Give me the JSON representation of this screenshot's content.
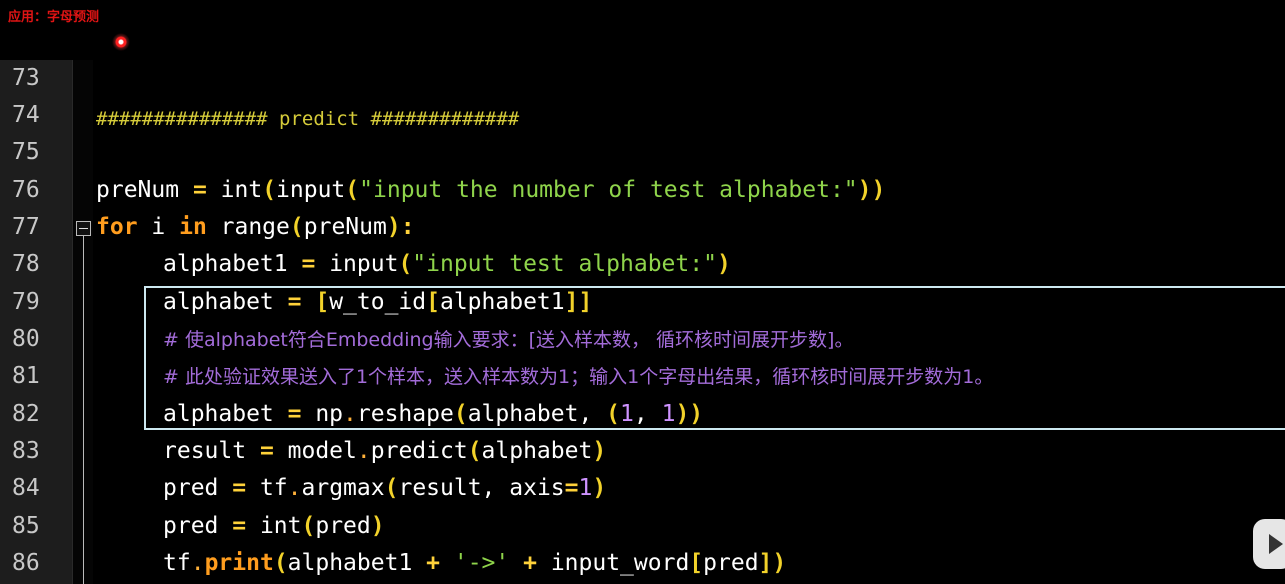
{
  "header": {
    "title": "应用：字母预测"
  },
  "line_numbers": [
    "73",
    "74",
    "75",
    "76",
    "77",
    "78",
    "79",
    "80",
    "81",
    "82",
    "83",
    "84",
    "85",
    "86"
  ],
  "code": {
    "l74_comment": "############### predict #############",
    "l76": {
      "a": "preNum ",
      "eq": "=",
      "b": " int",
      "p1": "(",
      "c": "input",
      "p2": "(",
      "s": "\"input the number of test alphabet:\"",
      "p3": "))"
    },
    "l77": {
      "kw_for": "for",
      "a": " i ",
      "kw_in": "in",
      "b": " range",
      "p1": "(",
      "c": "preNum",
      "p2": ")",
      "colon": ":"
    },
    "l78": {
      "a": "alphabet1 ",
      "eq": "=",
      "b": " input",
      "p1": "(",
      "s": "\"input test alphabet:\"",
      "p2": ")"
    },
    "l79": {
      "a": "alphabet ",
      "eq": "=",
      "p1": " [",
      "b": "w_to_id",
      "p2": "[",
      "c": "alphabet1",
      "p3": "]]"
    },
    "l80_comment": "# 使alphabet符合Embedding输入要求：[送入样本数， 循环核时间展开步数]。",
    "l81_comment": "# 此处验证效果送入了1个样本，送入样本数为1；输入1个字母出结果，循环核时间展开步数为1。",
    "l82": {
      "a": "alphabet ",
      "eq": "=",
      "b": " np",
      "dot": ".",
      "c": "reshape",
      "p1": "(",
      "d": "alphabet",
      "comma": ", ",
      "p2": "(",
      "n1": "1",
      "comma2": ", ",
      "n2": "1",
      "p3": "))"
    },
    "l83": {
      "a": "result ",
      "eq": "=",
      "b": " model",
      "dot": ".",
      "c": "predict",
      "p1": "(",
      "d": "alphabet",
      "p2": ")"
    },
    "l84": {
      "a": "pred ",
      "eq": "=",
      "b": " tf",
      "dot": ".",
      "c": "argmax",
      "p1": "(",
      "d": "result, axis",
      "eq2": "=",
      "n": "1",
      "p2": ")"
    },
    "l85": {
      "a": "pred ",
      "eq": "=",
      "b": " int",
      "p1": "(",
      "c": "pred",
      "p2": ")"
    },
    "l86": {
      "a": "tf",
      "dot": ".",
      "kw": "print",
      "p1": "(",
      "b": "alphabet1 ",
      "plus": "+",
      "s": " '->' ",
      "plus2": "+",
      "c": " input_word",
      "p2": "[",
      "d": "pred",
      "p3": "])"
    }
  },
  "colors": {
    "keyword": "#ff9d1e",
    "string": "#8fd44b",
    "comment": "#a36cd9",
    "number": "#ce93ff",
    "highlight_border": "#cde8f0"
  },
  "icons": {
    "cursor": "red-record-dot",
    "play": "play-icon"
  }
}
